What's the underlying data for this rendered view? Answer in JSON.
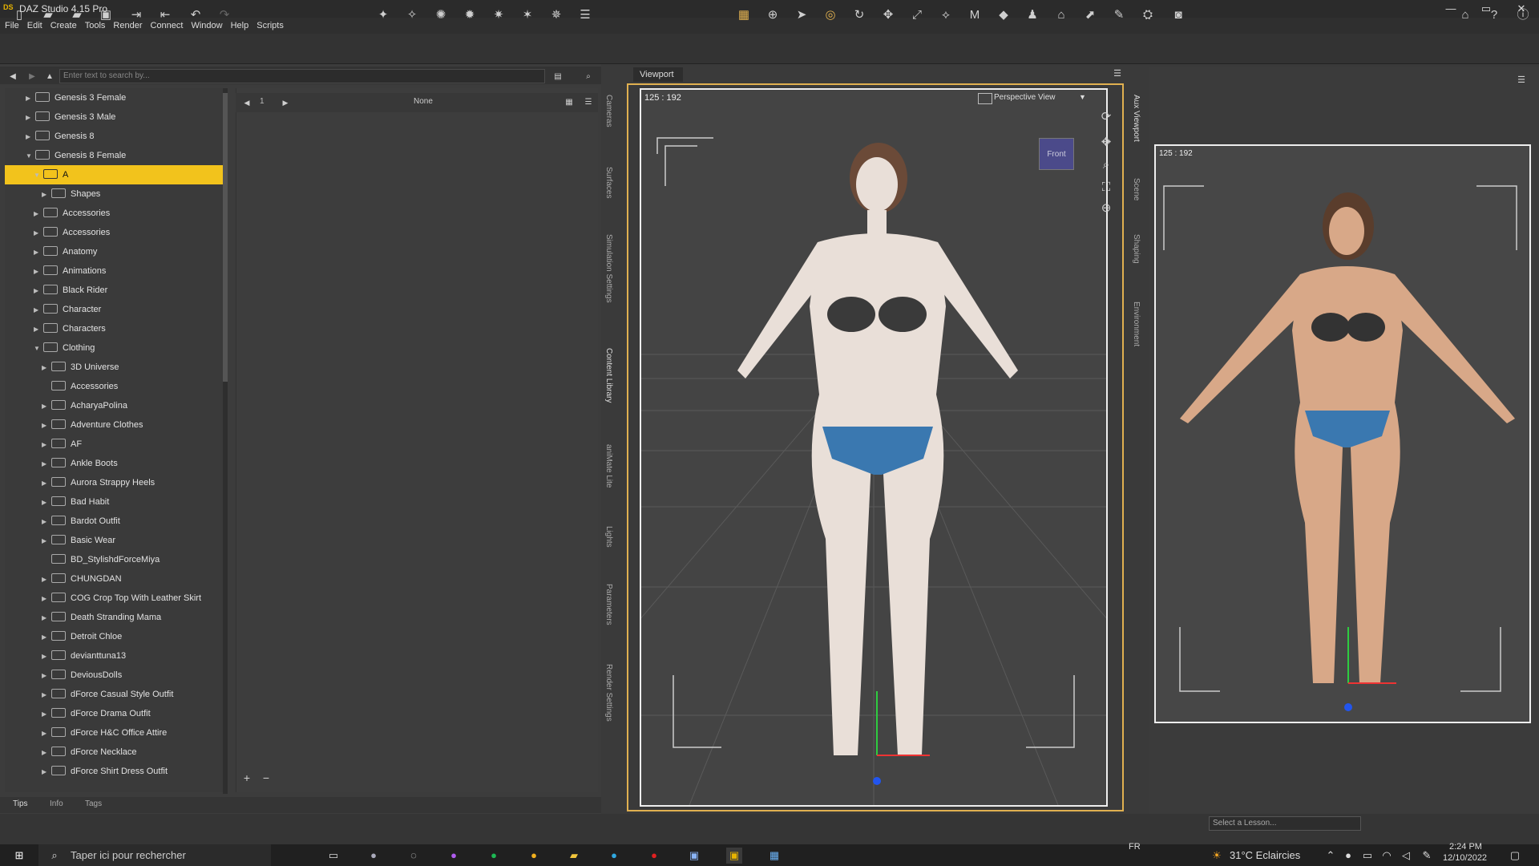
{
  "window": {
    "title": "DAZ Studio 4.15 Pro",
    "logo": "DS",
    "min": "—",
    "max": "▭",
    "close": "✕"
  },
  "menu": [
    "File",
    "Edit",
    "Create",
    "Tools",
    "Render",
    "Connect",
    "Window",
    "Help",
    "Scripts"
  ],
  "search": {
    "placeholder": "Enter text to search by..."
  },
  "content_toolbar": {
    "page": "1",
    "preset": "None"
  },
  "tree": [
    {
      "label": "Genesis 3 Female",
      "indent": 1,
      "expanded": false
    },
    {
      "label": "Genesis 3 Male",
      "indent": 1,
      "expanded": false
    },
    {
      "label": "Genesis 8",
      "indent": 1,
      "expanded": false
    },
    {
      "label": "Genesis 8 Female",
      "indent": 1,
      "expanded": true
    },
    {
      "label": "A",
      "indent": 2,
      "expanded": true,
      "selected": true
    },
    {
      "label": "Shapes",
      "indent": 3,
      "expanded": false
    },
    {
      "label": "Accessories",
      "indent": 2,
      "expanded": false
    },
    {
      "label": "Accessories",
      "indent": 2,
      "expanded": false
    },
    {
      "label": "Anatomy",
      "indent": 2,
      "expanded": false
    },
    {
      "label": "Animations",
      "indent": 2,
      "expanded": false
    },
    {
      "label": "Black Rider",
      "indent": 2,
      "expanded": false
    },
    {
      "label": "Character",
      "indent": 2,
      "expanded": false
    },
    {
      "label": "Characters",
      "indent": 2,
      "expanded": false
    },
    {
      "label": "Clothing",
      "indent": 2,
      "expanded": true
    },
    {
      "label": "3D Universe",
      "indent": 3,
      "expanded": false
    },
    {
      "label": "Accessories",
      "indent": 3,
      "expanded": null
    },
    {
      "label": "AcharyaPolina",
      "indent": 3,
      "expanded": false
    },
    {
      "label": "Adventure Clothes",
      "indent": 3,
      "expanded": false
    },
    {
      "label": "AF",
      "indent": 3,
      "expanded": false
    },
    {
      "label": "Ankle Boots",
      "indent": 3,
      "expanded": false
    },
    {
      "label": "Aurora Strappy Heels",
      "indent": 3,
      "expanded": false
    },
    {
      "label": "Bad Habit",
      "indent": 3,
      "expanded": false
    },
    {
      "label": "Bardot Outfit",
      "indent": 3,
      "expanded": false
    },
    {
      "label": "Basic Wear",
      "indent": 3,
      "expanded": false
    },
    {
      "label": "BD_StylishdForceMiya",
      "indent": 3,
      "expanded": null
    },
    {
      "label": "CHUNGDAN",
      "indent": 3,
      "expanded": false
    },
    {
      "label": "COG Crop Top With Leather Skirt",
      "indent": 3,
      "expanded": false
    },
    {
      "label": "Death Stranding Mama",
      "indent": 3,
      "expanded": false
    },
    {
      "label": "Detroit Chloe",
      "indent": 3,
      "expanded": false
    },
    {
      "label": "devianttuna13",
      "indent": 3,
      "expanded": false
    },
    {
      "label": "DeviousDolls",
      "indent": 3,
      "expanded": false
    },
    {
      "label": "dForce Casual Style Outfit",
      "indent": 3,
      "expanded": false
    },
    {
      "label": "dForce Drama Outfit",
      "indent": 3,
      "expanded": false
    },
    {
      "label": "dForce H&C Office Attire",
      "indent": 3,
      "expanded": false
    },
    {
      "label": "dForce Necklace",
      "indent": 3,
      "expanded": false
    },
    {
      "label": "dForce Shirt Dress Outfit",
      "indent": 3,
      "expanded": false
    }
  ],
  "bottom_tabs": [
    "Tips",
    "Info",
    "Tags"
  ],
  "side_tabs_left": [
    "Cameras",
    "Surfaces",
    "Simulation Settings",
    "Content Library",
    "aniMate Lite",
    "Lights",
    "Parameters",
    "Render Settings"
  ],
  "side_tabs_right": [
    "Aux Viewport",
    "Scene",
    "Shaping",
    "Environment"
  ],
  "viewport": {
    "tab": "Viewport",
    "resolution": "125 : 192",
    "view_mode": "Perspective View",
    "cube_label": "Front"
  },
  "aux": {
    "resolution": "125 : 192"
  },
  "lesson": {
    "placeholder": "Select a Lesson..."
  },
  "taskbar": {
    "search": "Taper ici pour rechercher",
    "lang": "FR",
    "weather": "31°C  Eclaircies",
    "time": "2:24 PM",
    "date": "12/10/2022"
  }
}
